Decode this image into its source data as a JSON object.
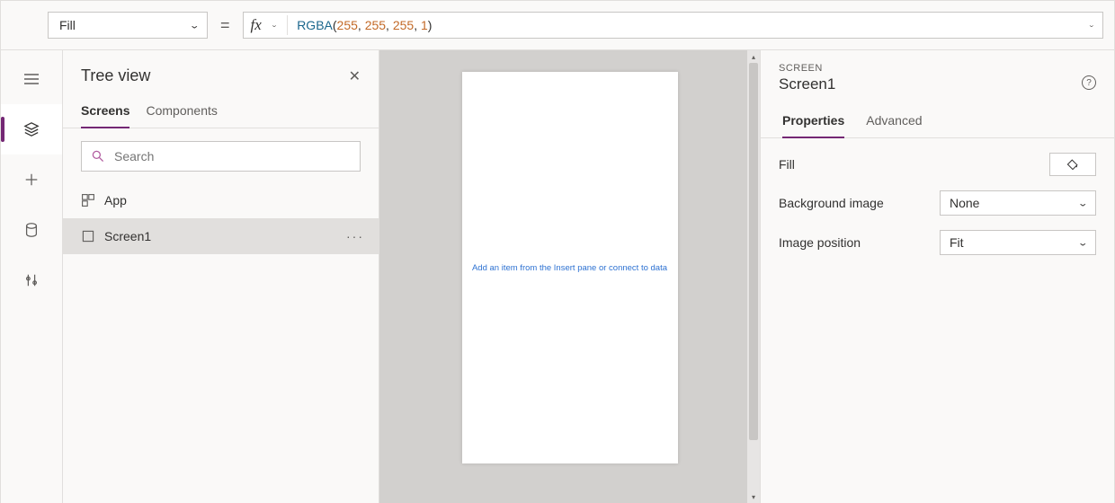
{
  "formula_bar": {
    "property": "Fill",
    "fx_label": "fx",
    "fn": "RGBA",
    "args": [
      "255",
      "255",
      "255",
      "1"
    ]
  },
  "tree_view": {
    "title": "Tree view",
    "tabs": {
      "screens": "Screens",
      "components": "Components"
    },
    "search_placeholder": "Search",
    "items": {
      "app": "App",
      "screen1": "Screen1"
    }
  },
  "canvas": {
    "hint": "Add an item from the Insert pane or connect to data"
  },
  "properties": {
    "category": "SCREEN",
    "name": "Screen1",
    "tabs": {
      "properties": "Properties",
      "advanced": "Advanced"
    },
    "rows": {
      "fill": "Fill",
      "bg_image": {
        "label": "Background image",
        "value": "None"
      },
      "img_pos": {
        "label": "Image position",
        "value": "Fit"
      }
    }
  }
}
